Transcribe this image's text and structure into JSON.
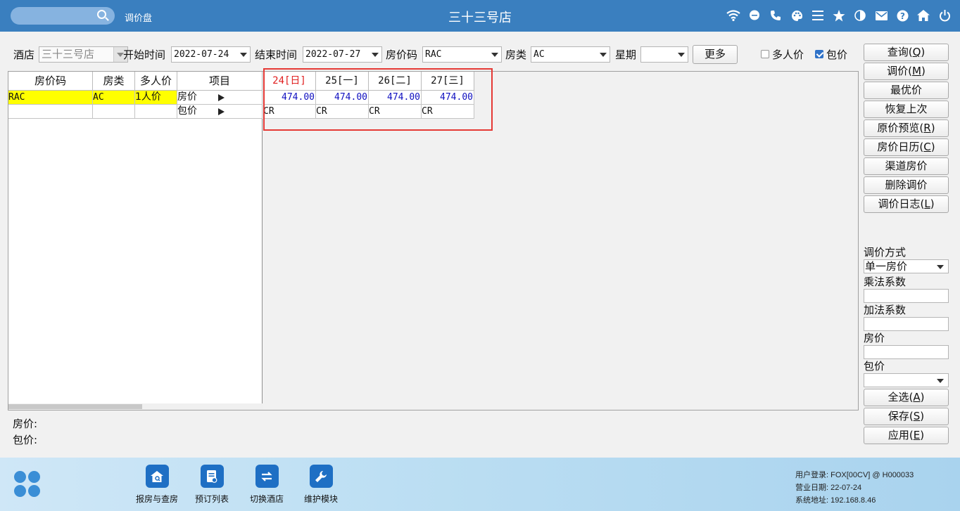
{
  "header": {
    "search_placeholder": "",
    "app_title": "调价盘",
    "store_title": "三十三号店",
    "icons": [
      "wifi-icon",
      "chat-icon",
      "phone-icon",
      "palette-icon",
      "menu-icon",
      "star-icon",
      "theme-icon",
      "mail-icon",
      "help-icon",
      "home-icon",
      "power-icon"
    ]
  },
  "filter": {
    "hotel_label": "酒店",
    "hotel_value": "三十三号店",
    "start_label": "开始时间",
    "start_value": "2022-07-24",
    "end_label": "结束时间",
    "end_value": "2022-07-27",
    "rate_code_label": "房价码",
    "rate_code_value": "RAC",
    "room_type_label": "房类",
    "room_type_value": "AC",
    "weekday_label": "星期",
    "weekday_value": "",
    "more_button": "更多",
    "multi_price_label": "多人价",
    "multi_price_checked": false,
    "package_label": "包价",
    "package_checked": true
  },
  "left_table": {
    "headers": [
      "房价码",
      "房类",
      "多人价",
      "项目"
    ],
    "row": {
      "rate_code": "RAC",
      "room_type": "AC",
      "multi": "1人价"
    },
    "items": [
      "房价",
      "包价"
    ]
  },
  "dates": [
    {
      "label": "24[日]",
      "is_sunday": true,
      "price": "474.00",
      "package": "CR"
    },
    {
      "label": "25[一]",
      "is_sunday": false,
      "price": "474.00",
      "package": "CR"
    },
    {
      "label": "26[二]",
      "is_sunday": false,
      "price": "474.00",
      "package": "CR"
    },
    {
      "label": "27[三]",
      "is_sunday": false,
      "price": "474.00",
      "package": "CR"
    }
  ],
  "summary": {
    "room_price_label": "房价:",
    "package_price_label": "包价:"
  },
  "side_buttons": [
    {
      "text": "查询",
      "key": "Q"
    },
    {
      "text": "调价",
      "key": "M"
    },
    {
      "text": "最优价",
      "key": ""
    },
    {
      "text": "恢复上次",
      "key": ""
    },
    {
      "text": "原价预览",
      "key": "R"
    },
    {
      "text": "房价日历",
      "key": "C"
    },
    {
      "text": "渠道房价",
      "key": ""
    },
    {
      "text": "删除调价",
      "key": ""
    },
    {
      "text": "调价日志",
      "key": "L"
    }
  ],
  "adjust_panel": {
    "method_label": "调价方式",
    "method_value": "单一房价",
    "multiplier_label": "乘法系数",
    "multiplier_value": "",
    "addend_label": "加法系数",
    "addend_value": "",
    "room_price_label": "房价",
    "room_price_value": "",
    "package_label": "包价",
    "package_value": ""
  },
  "bottom_buttons": [
    {
      "text": "全选",
      "key": "A"
    },
    {
      "text": "保存",
      "key": "S"
    },
    {
      "text": "应用",
      "key": "E"
    }
  ],
  "footer": {
    "modules": [
      "报房与查房",
      "预订列表",
      "切换酒店",
      "维护模块"
    ],
    "user_login": "用户登录:  FOX[00CV] @ H000033",
    "business_date": "营业日期:  22-07-24",
    "system_address": "系统地址:  192.168.8.46"
  },
  "colors": {
    "header_bg": "#3a7fbf",
    "highlight_row": "#ffff00",
    "sunday": "#e02020",
    "price_text": "#1010c0",
    "callout_box": "#e53935",
    "checkbox_checked": "#2f72c8",
    "footer_icon_bg": "#1e6fc4"
  }
}
